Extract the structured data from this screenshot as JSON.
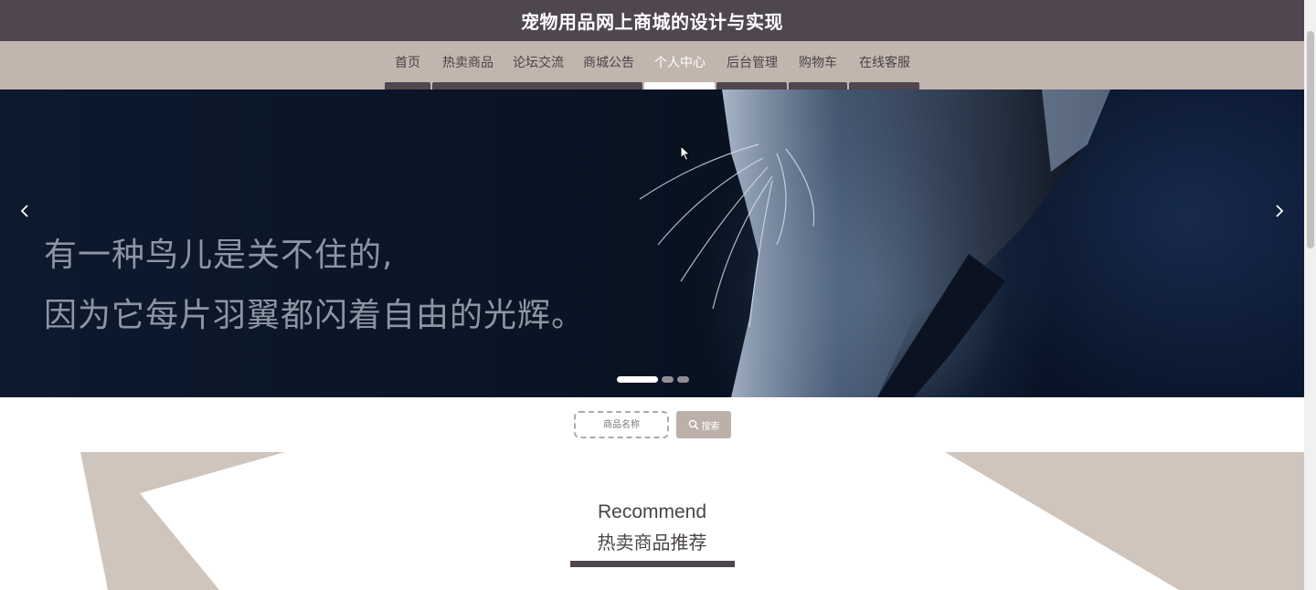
{
  "header": {
    "title": "宠物用品网上商城的设计与实现"
  },
  "nav": {
    "items": [
      {
        "label": "首页"
      },
      {
        "label": "热卖商品"
      },
      {
        "label": "论坛交流"
      },
      {
        "label": "商城公告"
      },
      {
        "label": "个人中心",
        "active": true
      },
      {
        "label": "后台管理"
      },
      {
        "label": "购物车"
      },
      {
        "label": "在线客服"
      }
    ]
  },
  "banner": {
    "line1": "有一种鸟儿是关不住的,",
    "line2": "因为它每片羽翼都闪着自由的光辉。",
    "prev_icon": "chevron-left-icon",
    "next_icon": "chevron-right-icon",
    "slide_count": 3,
    "active_slide": 1
  },
  "search": {
    "placeholder": "商品名称",
    "button_label": "搜索",
    "icon": "search-icon"
  },
  "recommend": {
    "title_en": "Recommend",
    "title_cn": "热卖商品推荐"
  },
  "colors": {
    "header_bg": "#4f4650",
    "nav_bg": "#c2b5ae",
    "accent": "#bdb0a9",
    "deco": "#cfc5bd"
  }
}
